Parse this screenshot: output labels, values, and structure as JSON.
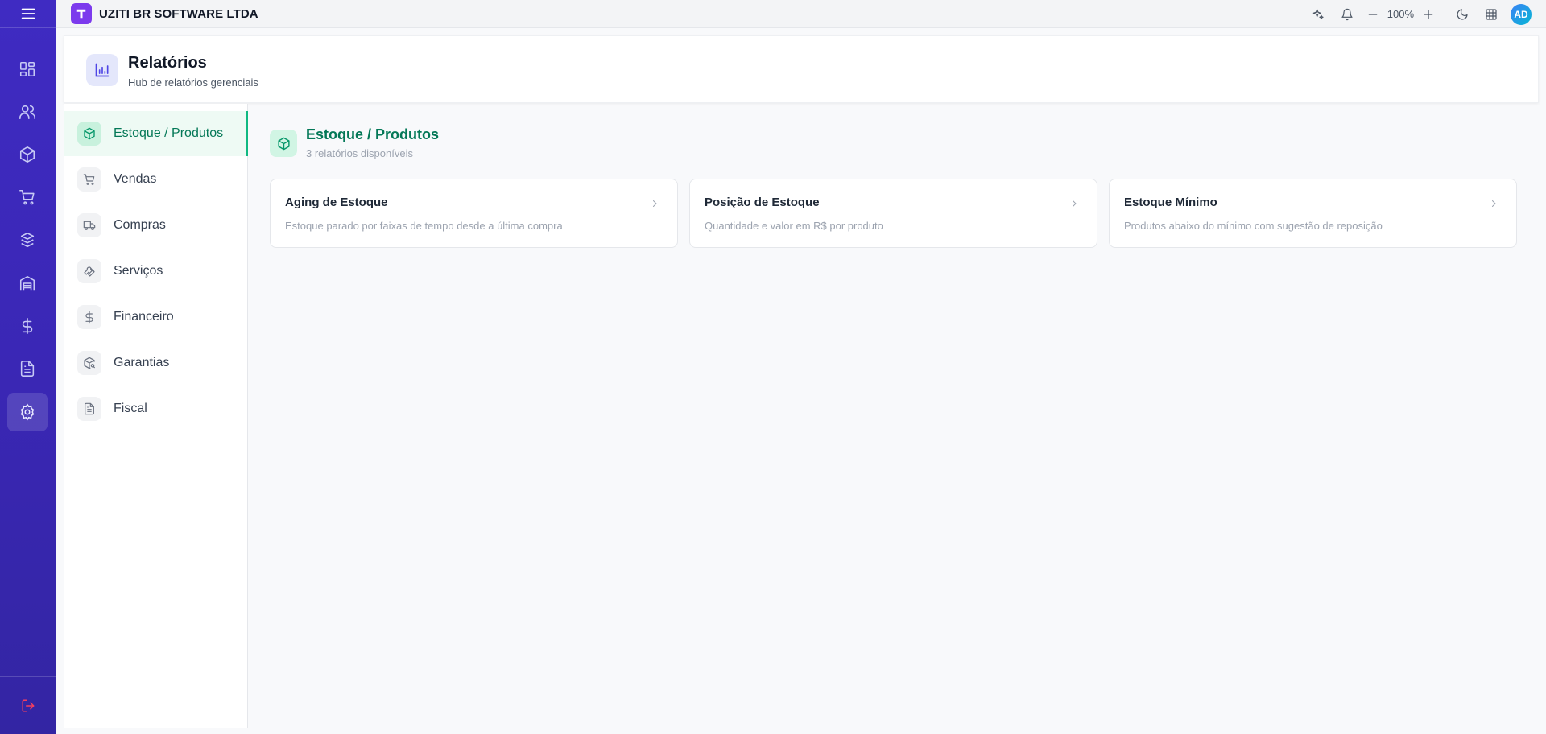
{
  "app": {
    "company": "UZITI BR SOFTWARE LTDA",
    "logo_letter": "T",
    "zoom": "100%",
    "user_initials": "AD"
  },
  "rail": {
    "items": [
      {
        "icon": "dashboard-grid-icon"
      },
      {
        "icon": "users-icon"
      },
      {
        "icon": "box-icon"
      },
      {
        "icon": "shopping-cart-icon"
      },
      {
        "icon": "boxes-stack-icon"
      },
      {
        "icon": "warehouse-icon"
      },
      {
        "icon": "dollar-sign-icon"
      },
      {
        "icon": "document-icon"
      },
      {
        "icon": "settings-gear-icon",
        "active": true
      }
    ],
    "logout_icon": "logout-icon"
  },
  "header": {
    "title": "Relatórios",
    "subtitle": "Hub de relatórios gerenciais"
  },
  "categories": [
    {
      "label": "Estoque / Produtos",
      "icon": "box-icon",
      "active": true
    },
    {
      "label": "Vendas",
      "icon": "shopping-cart-icon"
    },
    {
      "label": "Compras",
      "icon": "truck-icon"
    },
    {
      "label": "Serviços",
      "icon": "wrench-icon"
    },
    {
      "label": "Financeiro",
      "icon": "dollar-sign-icon"
    },
    {
      "label": "Garantias",
      "icon": "package-search-icon"
    },
    {
      "label": "Fiscal",
      "icon": "document-icon"
    }
  ],
  "section": {
    "title": "Estoque / Produtos",
    "subtitle": "3 relatórios disponíveis"
  },
  "reports": [
    {
      "title": "Aging de Estoque",
      "description": "Estoque parado por faixas de tempo desde a última compra"
    },
    {
      "title": "Posição de Estoque",
      "description": "Quantidade e valor em R$ por produto"
    },
    {
      "title": "Estoque Mínimo",
      "description": "Produtos abaixo do mínimo com sugestão de reposição"
    }
  ],
  "colors": {
    "rail": "#3a27b5",
    "accent_green": "#047857",
    "brand_purple": "#7c3aed",
    "logout_red": "#e11d48"
  }
}
